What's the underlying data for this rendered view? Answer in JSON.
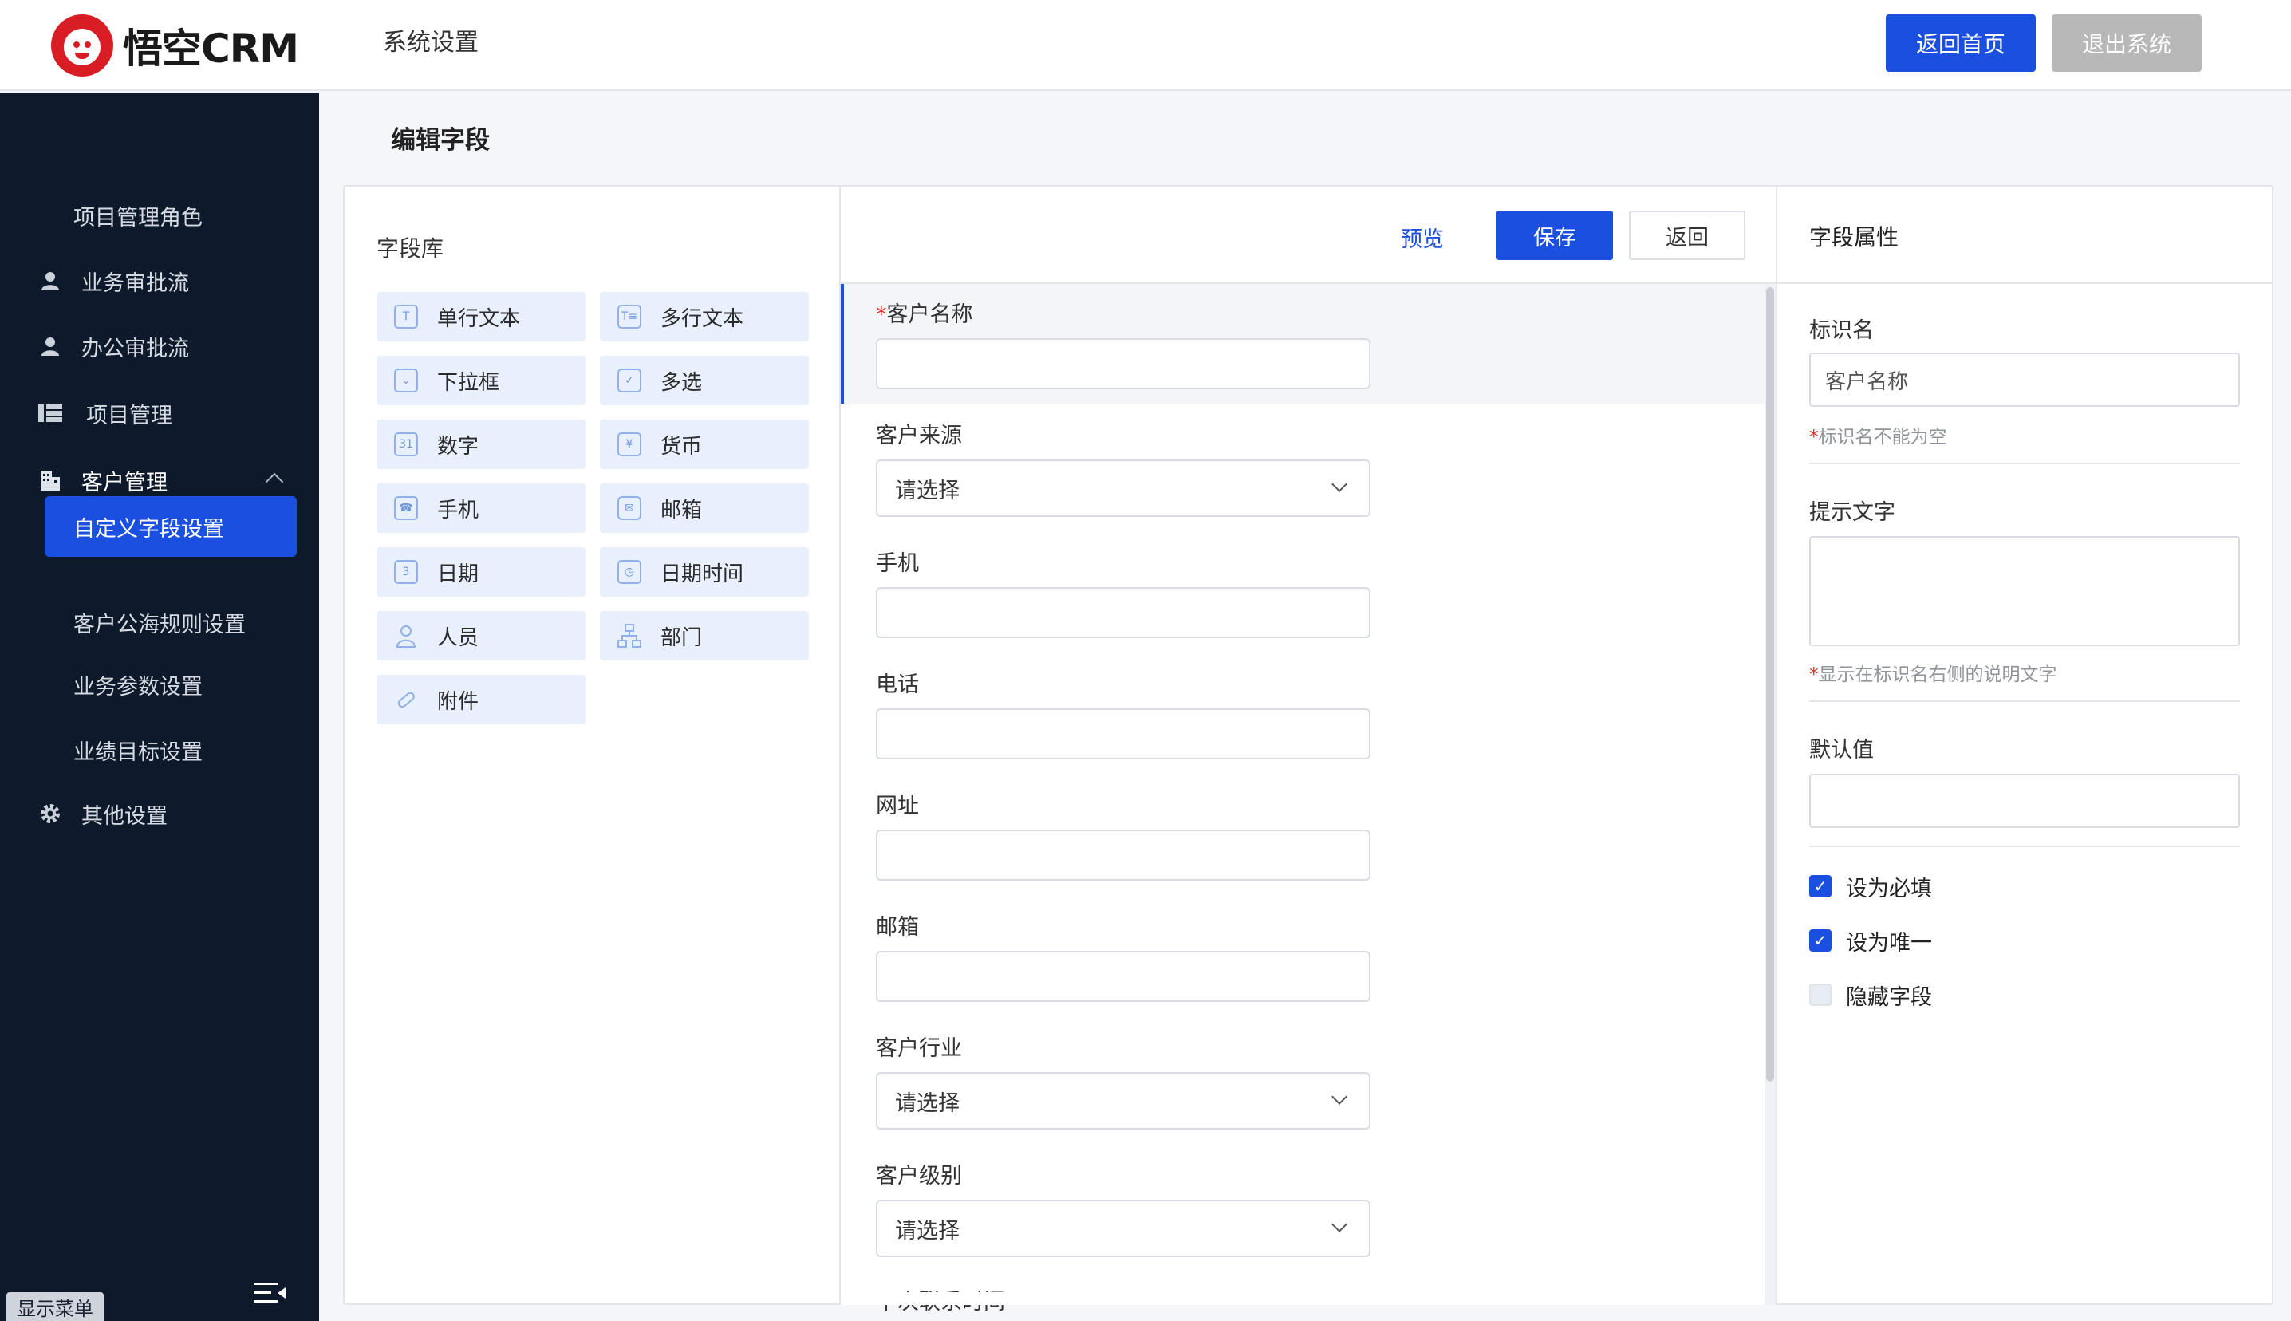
{
  "header": {
    "brand": "悟空CRM",
    "title": "系统设置",
    "home_button": "返回首页",
    "logout_button": "退出系统"
  },
  "sidebar": {
    "items": [
      {
        "label": "项目管理角色",
        "icon": ""
      },
      {
        "label": "业务审批流",
        "icon": "user-icon"
      },
      {
        "label": "办公审批流",
        "icon": "user-icon"
      },
      {
        "label": "项目管理",
        "icon": "list-icon"
      },
      {
        "label": "客户管理",
        "icon": "building-icon"
      },
      {
        "label": "自定义字段设置",
        "icon": ""
      },
      {
        "label": "客户公海规则设置",
        "icon": ""
      },
      {
        "label": "业务参数设置",
        "icon": ""
      },
      {
        "label": "业绩目标设置",
        "icon": ""
      },
      {
        "label": "其他设置",
        "icon": "gear-icon"
      }
    ],
    "toggle_label": "显示菜单"
  },
  "page": {
    "title": "编辑字段"
  },
  "library": {
    "title": "字段库",
    "fields": [
      {
        "label": "单行文本",
        "icon": "single-line-text-icon"
      },
      {
        "label": "多行文本",
        "icon": "multi-line-text-icon"
      },
      {
        "label": "下拉框",
        "icon": "dropdown-icon"
      },
      {
        "label": "多选",
        "icon": "multi-select-icon"
      },
      {
        "label": "数字",
        "icon": "number-icon"
      },
      {
        "label": "货币",
        "icon": "currency-icon"
      },
      {
        "label": "手机",
        "icon": "phone-icon"
      },
      {
        "label": "邮箱",
        "icon": "email-icon"
      },
      {
        "label": "日期",
        "icon": "date-icon"
      },
      {
        "label": "日期时间",
        "icon": "datetime-icon"
      },
      {
        "label": "人员",
        "icon": "person-icon"
      },
      {
        "label": "部门",
        "icon": "department-icon"
      },
      {
        "label": "附件",
        "icon": "attachment-icon"
      }
    ]
  },
  "toolbar": {
    "preview": "预览",
    "save": "保存",
    "back": "返回"
  },
  "form": {
    "fields": [
      {
        "label": "客户名称",
        "required": "*",
        "type": "input"
      },
      {
        "label": "客户来源",
        "type": "select",
        "value": "请选择"
      },
      {
        "label": "手机",
        "type": "input"
      },
      {
        "label": "电话",
        "type": "input"
      },
      {
        "label": "网址",
        "type": "input"
      },
      {
        "label": "邮箱",
        "type": "input"
      },
      {
        "label": "客户行业",
        "type": "select",
        "value": "请选择"
      },
      {
        "label": "客户级别",
        "type": "select",
        "value": "请选择"
      },
      {
        "label": "下次联系时间",
        "type": "input"
      }
    ]
  },
  "properties": {
    "title": "字段属性",
    "name_label": "标识名",
    "name_value": "客户名称",
    "name_hint_star": "*",
    "name_hint": "标识名不能为空",
    "tip_label": "提示文字",
    "tip_hint_star": "*",
    "tip_hint": "显示在标识名右侧的说明文字",
    "default_label": "默认值",
    "checkboxes": [
      {
        "label": "设为必填",
        "checked": true
      },
      {
        "label": "设为唯一",
        "checked": true
      },
      {
        "label": "隐藏字段",
        "checked": false
      }
    ]
  },
  "colors": {
    "accent": "#1a4fe0",
    "sidebar_bg": "#0e1a2b",
    "chip_bg": "#e9f0fd",
    "required": "#e03131"
  }
}
